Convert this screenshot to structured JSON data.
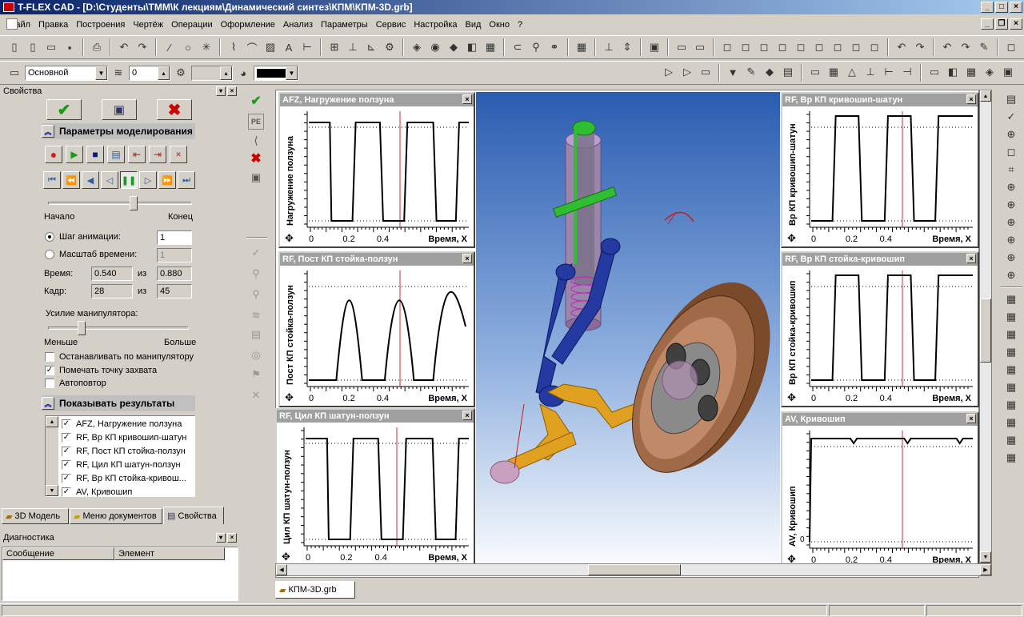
{
  "app": {
    "title": "T-FLEX CAD - [D:\\Студенты\\ТММ\\К лекциям\\Динамический синтез\\КПМ\\КПМ-3D.grb]"
  },
  "menu": [
    "Файл",
    "Правка",
    "Построения",
    "Чертёж",
    "Операции",
    "Оформление",
    "Анализ",
    "Параметры",
    "Сервис",
    "Настройка",
    "Вид",
    "Окно",
    "?"
  ],
  "toolbar2": {
    "layer": "Основной",
    "level": "0"
  },
  "properties": {
    "title": "Свойства",
    "sim_section": "Параметры моделирования",
    "start_label": "Начало",
    "end_label": "Конец",
    "anim_step_label": "Шаг анимации:",
    "anim_step_value": "1",
    "time_scale_label": "Масштаб времени:",
    "time_scale_value": "1",
    "time_label": "Время:",
    "time_value": "0.540",
    "time_of": "из",
    "time_total": "0.880",
    "frame_label": "Кадр:",
    "frame_value": "28",
    "frame_of": "из",
    "frame_total": "45",
    "manip_label": "Усилие манипулятора:",
    "less_label": "Меньше",
    "more_label": "Больше",
    "cb_stop": "Останавливать по манипулятору",
    "cb_mark": "Помечать точку захвата",
    "cb_repeat": "Автоповтор",
    "results_section": "Показывать результаты",
    "results": [
      "AFZ, Нагружение ползуна",
      "RF, Вр КП кривошип-шатун",
      "RF, Пост КП стойка-ползун",
      "RF, Цил КП шатун-ползун",
      "RF, Вр КП стойка-кривош...",
      "AV, Кривошип"
    ],
    "slider_pos": 0.6,
    "manip_pos": 0.22
  },
  "bottom_tabs": [
    "3D Модель",
    "Меню документов",
    "Свойства"
  ],
  "diagnostics": {
    "title": "Диагностика",
    "col1": "Сообщение",
    "col2": "Элемент"
  },
  "document_tab": "КПМ-3D.grb",
  "plots": [
    {
      "title": "AFZ, Нагружение ползуна",
      "ylabel": "Нагружение ползуна",
      "xlabel": "Время, Х",
      "ticks": [
        "0",
        "0.2",
        "0.4"
      ]
    },
    {
      "title": "RF, Пост КП стойка-ползун",
      "ylabel": "Пост КП стойка-ползун",
      "xlabel": "Время, Х",
      "ticks": [
        "0",
        "0.2",
        "0.4"
      ]
    },
    {
      "title": "RF, Цил КП шатун-ползун",
      "ylabel": "Цил КП шатун-ползун",
      "xlabel": "Время, Х",
      "ticks": [
        "0",
        "0.2",
        "0.4"
      ]
    },
    {
      "title": "RF, Вр КП кривошип-шатун",
      "ylabel": "Вр КП кривошип-шатун",
      "xlabel": "Время, Х",
      "ticks": [
        "0",
        "0.2",
        "0.4"
      ]
    },
    {
      "title": "RF, Вр КП стойка-кривошип",
      "ylabel": "Вр КП стойка-кривошип",
      "xlabel": "Время, Х",
      "ticks": [
        "0",
        "0.2",
        "0.4"
      ]
    },
    {
      "title": "AV, Кривошип",
      "ylabel": "AV, Кривошип",
      "xlabel": "Время, Х",
      "ticks": [
        "0",
        "0.2",
        "0.4"
      ],
      "y0": "0"
    }
  ],
  "colors": {
    "title_start": "#0a246a",
    "title_end": "#a6caf0",
    "viewport_top": "#2a5cb0",
    "viewport_bottom": "#ffffff"
  }
}
